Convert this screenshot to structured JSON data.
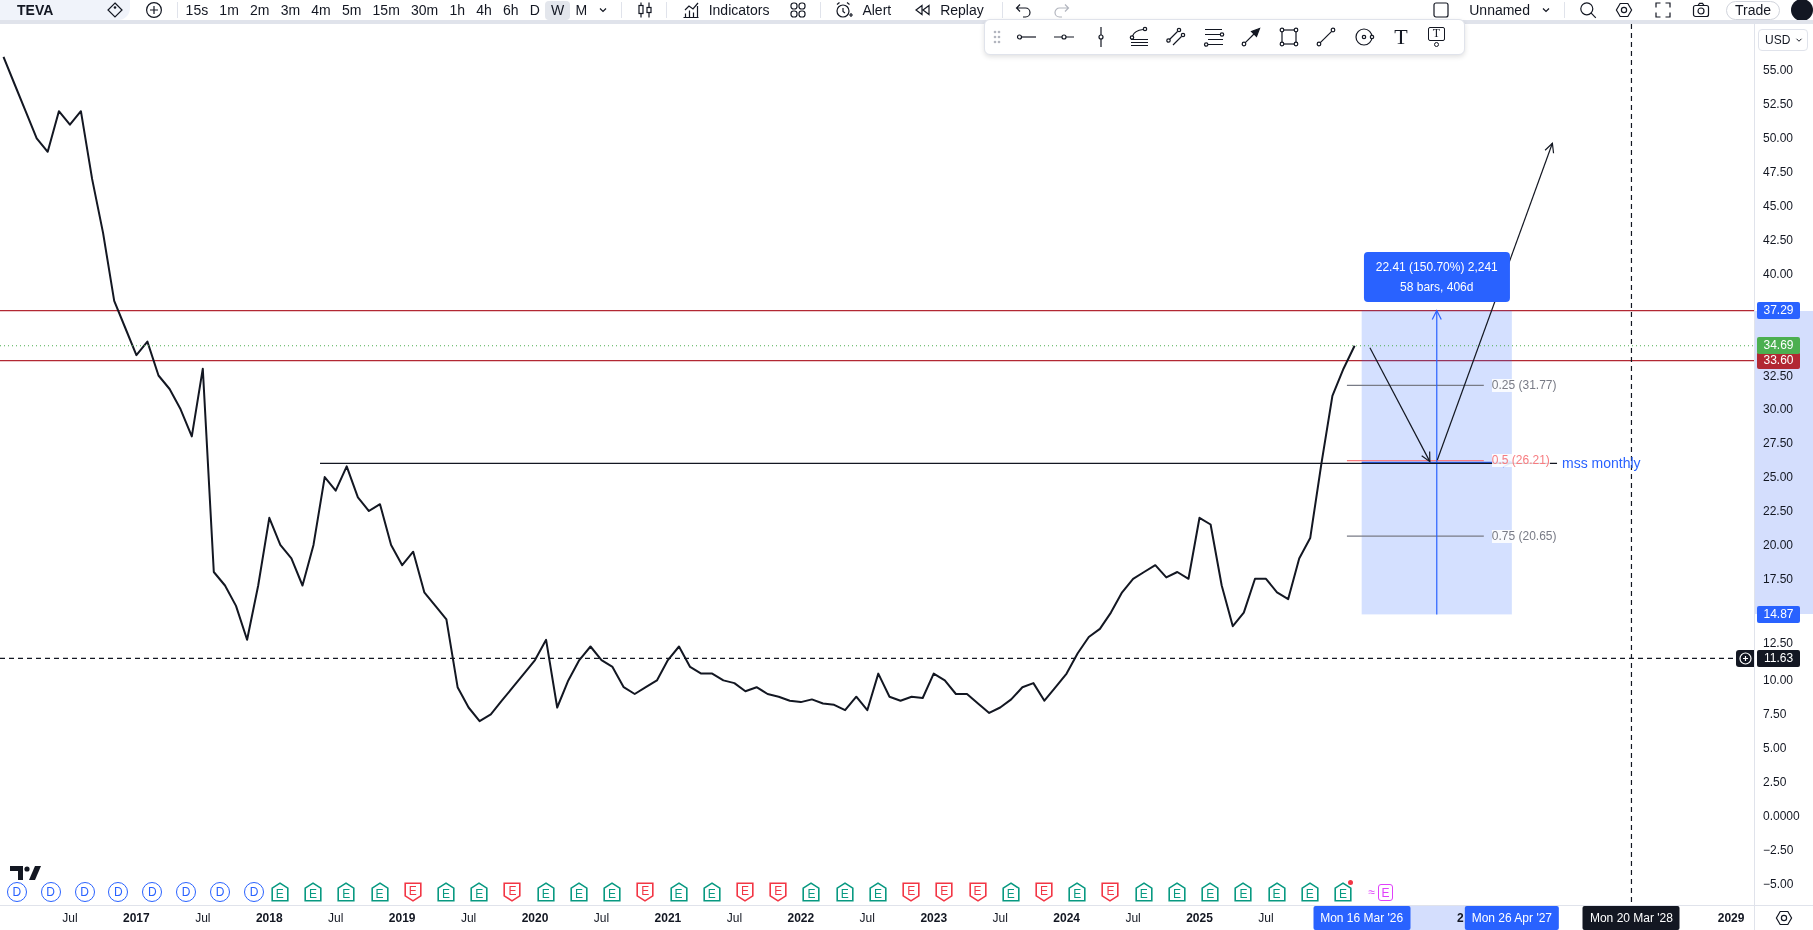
{
  "toolbar": {
    "symbol": "TEVA",
    "intervals": [
      {
        "label": "15s",
        "selected": false
      },
      {
        "label": "1m",
        "selected": false
      },
      {
        "label": "2m",
        "selected": false
      },
      {
        "label": "3m",
        "selected": false
      },
      {
        "label": "4m",
        "selected": false
      },
      {
        "label": "5m",
        "selected": false
      },
      {
        "label": "15m",
        "selected": false
      },
      {
        "label": "30m",
        "selected": false
      },
      {
        "label": "1h",
        "selected": false
      },
      {
        "label": "4h",
        "selected": false
      },
      {
        "label": "6h",
        "selected": false
      },
      {
        "label": "D",
        "selected": false
      },
      {
        "label": "W",
        "selected": true
      },
      {
        "label": "M",
        "selected": false
      }
    ],
    "actions": [
      {
        "kind": "indicators",
        "label": "Indicators"
      },
      {
        "kind": "alert",
        "label": "Alert"
      },
      {
        "kind": "replay",
        "label": "Replay"
      }
    ],
    "history": [
      {
        "kind": "undo",
        "disabled": false
      },
      {
        "kind": "redo",
        "disabled": true
      }
    ],
    "layout_name": "Unnamed",
    "trade_label": "Trade"
  },
  "drawing_toolbar": {
    "text_tools": [
      {
        "kind": "text",
        "glyph": "T"
      },
      {
        "kind": "note",
        "glyph": "T"
      }
    ]
  },
  "chart": {
    "currency": "USD",
    "chart_data": {
      "type": "line",
      "x": [
        2016,
        2016.083,
        2016.167,
        2016.25,
        2016.333,
        2016.417,
        2016.5,
        2016.583,
        2016.667,
        2016.75,
        2016.833,
        2016.917,
        2017,
        2017.083,
        2017.167,
        2017.25,
        2017.333,
        2017.417,
        2017.5,
        2017.583,
        2017.667,
        2017.75,
        2017.833,
        2017.917,
        2018,
        2018.083,
        2018.167,
        2018.25,
        2018.333,
        2018.417,
        2018.5,
        2018.583,
        2018.667,
        2018.75,
        2018.833,
        2018.917,
        2019,
        2019.083,
        2019.167,
        2019.25,
        2019.333,
        2019.417,
        2019.5,
        2019.583,
        2019.667,
        2019.75,
        2019.833,
        2019.917,
        2020,
        2020.083,
        2020.167,
        2020.25,
        2020.333,
        2020.417,
        2020.5,
        2020.583,
        2020.667,
        2020.75,
        2020.833,
        2020.917,
        2021,
        2021.083,
        2021.167,
        2021.25,
        2021.333,
        2021.417,
        2021.5,
        2021.583,
        2021.667,
        2021.75,
        2021.833,
        2021.917,
        2022,
        2022.083,
        2022.167,
        2022.25,
        2022.333,
        2022.417,
        2022.5,
        2022.583,
        2022.667,
        2022.75,
        2022.833,
        2022.917,
        2023,
        2023.083,
        2023.167,
        2023.25,
        2023.333,
        2023.417,
        2023.5,
        2023.583,
        2023.667,
        2023.75,
        2023.833,
        2023.917,
        2024,
        2024.083,
        2024.167,
        2024.25,
        2024.333,
        2024.417,
        2024.5,
        2024.583,
        2024.667,
        2024.75,
        2024.833,
        2024.917,
        2025,
        2025.083,
        2025.167,
        2025.25,
        2025.333,
        2025.417,
        2025.5,
        2025.583,
        2025.667,
        2025.75,
        2025.833,
        2025.917,
        2026,
        2026.083,
        2026.167
      ],
      "series": [
        {
          "color": "#131722",
          "values": [
            56,
            54,
            52,
            50,
            49,
            52,
            51,
            52,
            47,
            43,
            38,
            36,
            34,
            35,
            32.5,
            31.5,
            30,
            28,
            33,
            18,
            17,
            15.5,
            13,
            17,
            22,
            20,
            19,
            17,
            20,
            25,
            24,
            25.8,
            23.5,
            22.5,
            23,
            20,
            18.5,
            19.5,
            16.5,
            15.5,
            14.5,
            9.5,
            8,
            7,
            7.5,
            8.5,
            9.5,
            10.5,
            11.5,
            13,
            8,
            10,
            11.5,
            12.5,
            11.5,
            11,
            9.5,
            9,
            9.5,
            10,
            11.5,
            12.5,
            11,
            10.5,
            10.5,
            10,
            9.8,
            9.2,
            9.5,
            9,
            8.8,
            8.5,
            8.4,
            8.6,
            8.3,
            8.2,
            7.8,
            8.8,
            7.8,
            10.5,
            8.8,
            8.5,
            8.8,
            8.7,
            10.5,
            10,
            9,
            9,
            8.3,
            7.6,
            8,
            8.6,
            9.5,
            9.8,
            8.5,
            9.5,
            10.5,
            12,
            13.2,
            13.8,
            15,
            16.5,
            17.5,
            18,
            18.5,
            17.6,
            18,
            17.5,
            22,
            21.5,
            17,
            14,
            15,
            17.5,
            17.5,
            16.5,
            16,
            19,
            20.5,
            26,
            31,
            33,
            34.69
          ]
        }
      ],
      "xlim": [
        2015.974,
        2029.616
      ],
      "ylim": [
        -6.57,
        58.43
      ],
      "xticks": [
        {
          "value": 2016.5,
          "label": "Jul"
        },
        {
          "value": 2017,
          "label": "2017"
        },
        {
          "value": 2017.5,
          "label": "Jul"
        },
        {
          "value": 2018,
          "label": "2018"
        },
        {
          "value": 2018.5,
          "label": "Jul"
        },
        {
          "value": 2019,
          "label": "2019"
        },
        {
          "value": 2019.5,
          "label": "Jul"
        },
        {
          "value": 2020,
          "label": "2020"
        },
        {
          "value": 2020.5,
          "label": "Jul"
        },
        {
          "value": 2021,
          "label": "2021"
        },
        {
          "value": 2021.5,
          "label": "Jul"
        },
        {
          "value": 2022,
          "label": "2022"
        },
        {
          "value": 2022.5,
          "label": "Jul"
        },
        {
          "value": 2023,
          "label": "2023"
        },
        {
          "value": 2023.5,
          "label": "Jul"
        },
        {
          "value": 2024,
          "label": "2024"
        },
        {
          "value": 2024.5,
          "label": "Jul"
        },
        {
          "value": 2025,
          "label": "2025"
        },
        {
          "value": 2025.5,
          "label": "Jul"
        },
        {
          "value": 2029,
          "label": "2029"
        }
      ],
      "yticks": [
        {
          "value": 55,
          "label": "55.00"
        },
        {
          "value": 52.5,
          "label": "52.50"
        },
        {
          "value": 50,
          "label": "50.00"
        },
        {
          "value": 47.5,
          "label": "47.50"
        },
        {
          "value": 45,
          "label": "45.00"
        },
        {
          "value": 42.5,
          "label": "42.50"
        },
        {
          "value": 40,
          "label": "40.00"
        },
        {
          "value": 32.5,
          "label": "32.50"
        },
        {
          "value": 30,
          "label": "30.00"
        },
        {
          "value": 27.5,
          "label": "27.50"
        },
        {
          "value": 25,
          "label": "25.00"
        },
        {
          "value": 22.5,
          "label": "22.50"
        },
        {
          "value": 20,
          "label": "20.00"
        },
        {
          "value": 17.5,
          "label": "17.50"
        },
        {
          "value": 12.5,
          "label": "12.50"
        },
        {
          "value": 10,
          "label": "10.00"
        },
        {
          "value": 7.5,
          "label": "7.50"
        },
        {
          "value": 5,
          "label": "5.00"
        },
        {
          "value": 2.5,
          "label": "2.50"
        },
        {
          "value": 0,
          "label": "0.0000"
        },
        {
          "value": -2.5,
          "label": "−2.50"
        },
        {
          "value": -5,
          "label": "−5.00"
        }
      ],
      "annotations": [
        "mss monthly",
        "0.25 (31.77)",
        "0.5 (26.21)",
        "0.75 (20.65)"
      ],
      "ref_lines": [
        {
          "axis": "y",
          "value": 37.29,
          "color": "#b22833"
        },
        {
          "axis": "y",
          "value": 33.6,
          "color": "#b22833",
          "label": "33.60"
        },
        {
          "axis": "y",
          "value": 34.69,
          "color": "#4caf50",
          "label": "34.69"
        },
        {
          "axis": "x",
          "value": 2028.25,
          "label": "Mon 20 Mar '28"
        },
        {
          "axis": "y",
          "value": 11.63,
          "label": "11.63"
        }
      ],
      "bands": [
        {
          "axis": "x",
          "from": 2026.22,
          "to": 2027.35,
          "color": "#2962ff"
        }
      ]
    },
    "measure": {
      "lines": [
        "22.41 (150.70%) 2,241",
        "58 bars, 406d"
      ],
      "x_labels": [
        "Mon 16 Mar '26",
        "Mon 26 Apr '27"
      ],
      "y_labels": [
        "37.29",
        "14.87"
      ]
    },
    "time_axis_cut_label": "2",
    "events": [
      {
        "kind": "dividend",
        "label": "D",
        "color": "#2962ff",
        "dot": false
      },
      {
        "kind": "dividend",
        "label": "D",
        "color": "#2962ff",
        "dot": false
      },
      {
        "kind": "dividend",
        "label": "D",
        "color": "#2962ff",
        "dot": false
      },
      {
        "kind": "dividend",
        "label": "D",
        "color": "#2962ff",
        "dot": false
      },
      {
        "kind": "dividend",
        "label": "D",
        "color": "#2962ff",
        "dot": false
      },
      {
        "kind": "dividend",
        "label": "D",
        "color": "#2962ff",
        "dot": false
      },
      {
        "kind": "dividend",
        "label": "D",
        "color": "#2962ff",
        "dot": false
      },
      {
        "kind": "dividend",
        "label": "D",
        "color": "#2962ff",
        "dot": false
      },
      {
        "kind": "earnings_up",
        "label": "E",
        "color": "#089981",
        "dot": false
      },
      {
        "kind": "earnings_up",
        "label": "E",
        "color": "#089981",
        "dot": false
      },
      {
        "kind": "earnings_up",
        "label": "E",
        "color": "#089981",
        "dot": false
      },
      {
        "kind": "earnings_up",
        "label": "E",
        "color": "#089981",
        "dot": false
      },
      {
        "kind": "earnings_down",
        "label": "E",
        "color": "#f23645",
        "dot": false
      },
      {
        "kind": "earnings_up",
        "label": "E",
        "color": "#089981",
        "dot": false
      },
      {
        "kind": "earnings_up",
        "label": "E",
        "color": "#089981",
        "dot": false
      },
      {
        "kind": "earnings_down",
        "label": "E",
        "color": "#f23645",
        "dot": false
      },
      {
        "kind": "earnings_up",
        "label": "E",
        "color": "#089981",
        "dot": false
      },
      {
        "kind": "earnings_up",
        "label": "E",
        "color": "#089981",
        "dot": false
      },
      {
        "kind": "earnings_up",
        "label": "E",
        "color": "#089981",
        "dot": false
      },
      {
        "kind": "earnings_down",
        "label": "E",
        "color": "#f23645",
        "dot": false
      },
      {
        "kind": "earnings_up",
        "label": "E",
        "color": "#089981",
        "dot": false
      },
      {
        "kind": "earnings_up",
        "label": "E",
        "color": "#089981",
        "dot": false
      },
      {
        "kind": "earnings_down",
        "label": "E",
        "color": "#f23645",
        "dot": false
      },
      {
        "kind": "earnings_down",
        "label": "E",
        "color": "#f23645",
        "dot": false
      },
      {
        "kind": "earnings_up",
        "label": "E",
        "color": "#089981",
        "dot": false
      },
      {
        "kind": "earnings_up",
        "label": "E",
        "color": "#089981",
        "dot": false
      },
      {
        "kind": "earnings_up",
        "label": "E",
        "color": "#089981",
        "dot": false
      },
      {
        "kind": "earnings_down",
        "label": "E",
        "color": "#f23645",
        "dot": false
      },
      {
        "kind": "earnings_down",
        "label": "E",
        "color": "#f23645",
        "dot": false
      },
      {
        "kind": "earnings_down",
        "label": "E",
        "color": "#f23645",
        "dot": false
      },
      {
        "kind": "earnings_up",
        "label": "E",
        "color": "#089981",
        "dot": false
      },
      {
        "kind": "earnings_down",
        "label": "E",
        "color": "#f23645",
        "dot": false
      },
      {
        "kind": "earnings_up",
        "label": "E",
        "color": "#089981",
        "dot": false
      },
      {
        "kind": "earnings_down",
        "label": "E",
        "color": "#f23645",
        "dot": false
      },
      {
        "kind": "earnings_up",
        "label": "E",
        "color": "#089981",
        "dot": false
      },
      {
        "kind": "earnings_up",
        "label": "E",
        "color": "#089981",
        "dot": false
      },
      {
        "kind": "earnings_up",
        "label": "E",
        "color": "#089981",
        "dot": false
      },
      {
        "kind": "earnings_up",
        "label": "E",
        "color": "#089981",
        "dot": false
      },
      {
        "kind": "earnings_up",
        "label": "E",
        "color": "#089981",
        "dot": false
      },
      {
        "kind": "earnings_up",
        "label": "E",
        "color": "#089981",
        "dot": false
      },
      {
        "kind": "earnings_up",
        "label": "E",
        "color": "#089981",
        "dot": true
      },
      {
        "kind": "earnings_upcoming",
        "label": "E",
        "prefix": "≈",
        "color": "#e040fb",
        "dot": false
      }
    ]
  }
}
